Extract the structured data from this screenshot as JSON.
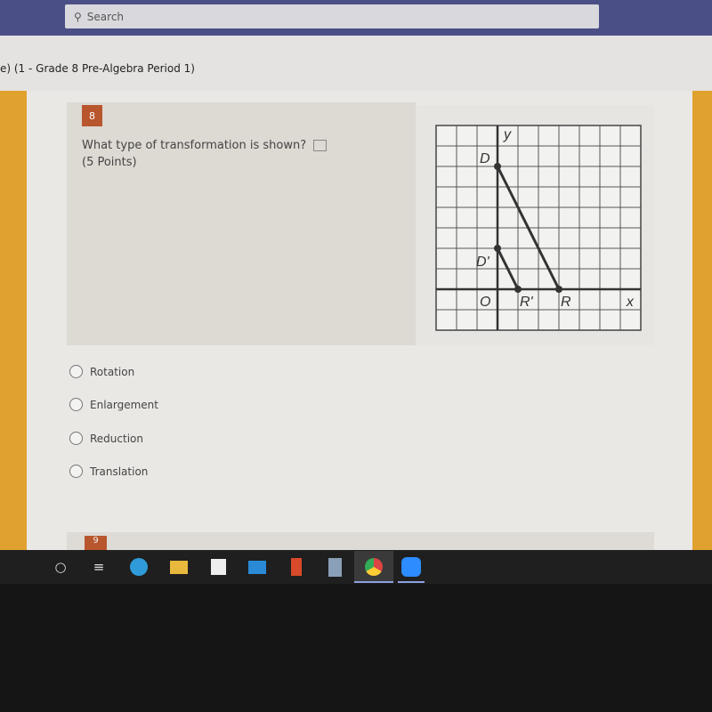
{
  "search": {
    "placeholder": "Search",
    "icon": "search-icon"
  },
  "header": {
    "title": "e) (1 - Grade 8 Pre-Algebra Period 1)"
  },
  "question": {
    "number": "8",
    "text": "What type of transformation is shown?",
    "points": "(5 Points)",
    "immersive_reader_icon": "immersive-reader-icon",
    "figure": {
      "labels": {
        "y": "y",
        "x": "x",
        "origin": "O",
        "D": "D",
        "D_prime": "D'",
        "R": "R",
        "R_prime": "R'"
      },
      "points": {
        "D": [
          0,
          6
        ],
        "R": [
          3,
          0
        ],
        "D_prime": [
          0,
          2
        ],
        "R_prime": [
          1,
          0
        ]
      }
    },
    "options": [
      "Rotation",
      "Enlargement",
      "Reduction",
      "Translation"
    ]
  },
  "next_question": {
    "number": "9"
  },
  "colors": {
    "accent": "#b8562e",
    "side": "#e0a12f",
    "topbar": "#4a4f86"
  },
  "taskbar": {
    "icons": [
      "cortana-icon",
      "task-view-icon",
      "edge-icon",
      "file-explorer-icon",
      "store-icon",
      "mail-icon",
      "office-icon",
      "calculator-icon",
      "chrome-icon",
      "zoom-icon"
    ]
  }
}
